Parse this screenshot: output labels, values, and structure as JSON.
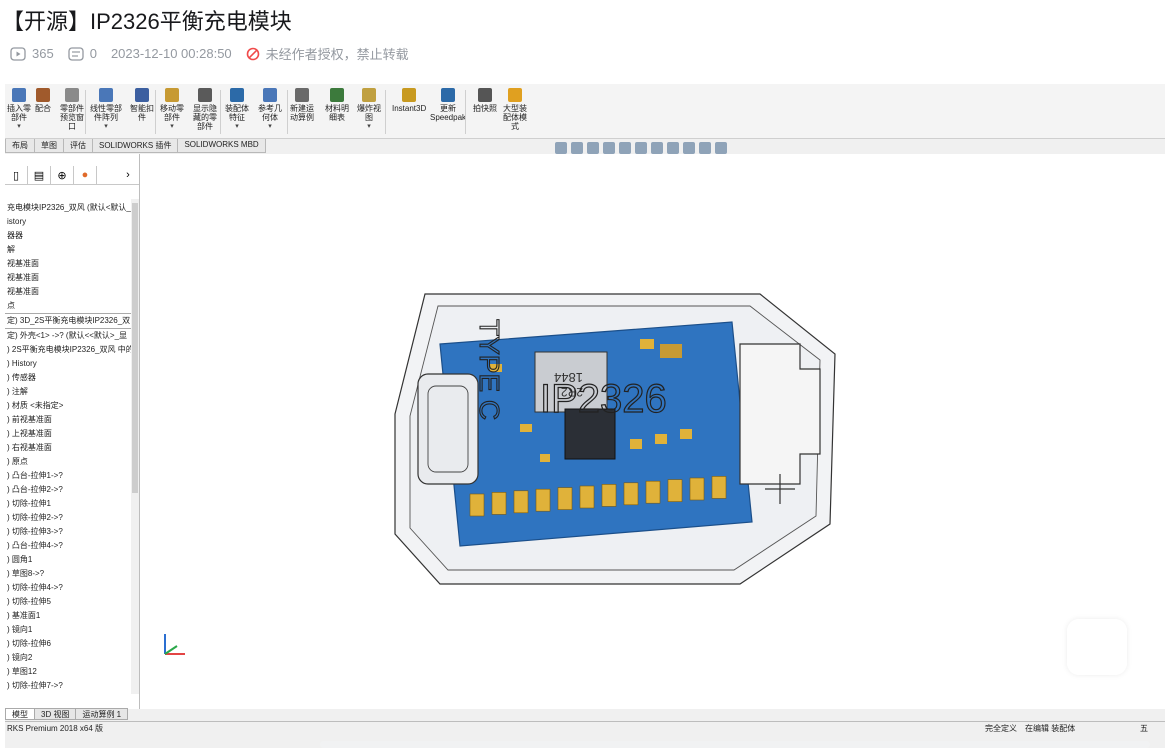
{
  "title": "【开源】IP2326平衡充电模块",
  "meta": {
    "views": "365",
    "danmaku": "0",
    "datetime": "2023-12-10 00:28:50",
    "copyright": "未经作者授权，禁止转载"
  },
  "watermark": "",
  "ribbon": {
    "buttons": [
      {
        "label": "插入零\n部件",
        "arrow": "▾"
      },
      {
        "label": "配合",
        "arrow": ""
      },
      {
        "label": "零部件\n预览窗\n口",
        "arrow": ""
      },
      {
        "label": "线性零部\n件阵列",
        "arrow": "▾"
      },
      {
        "label": "智能扣\n件",
        "arrow": ""
      },
      {
        "label": "移动零\n部件",
        "arrow": "▾"
      },
      {
        "label": "显示隐\n藏的零\n部件",
        "arrow": ""
      },
      {
        "label": "装配体\n特征",
        "arrow": "▾"
      },
      {
        "label": "参考几\n何体",
        "arrow": "▾"
      },
      {
        "label": "新建运\n动算例",
        "arrow": ""
      },
      {
        "label": "材料明\n细表",
        "arrow": ""
      },
      {
        "label": "爆炸视\n图",
        "arrow": "▾"
      },
      {
        "label": "Instant3D",
        "arrow": ""
      },
      {
        "label": "更新\nSpeedpak",
        "arrow": ""
      },
      {
        "label": "拍快照",
        "arrow": ""
      },
      {
        "label": "大型装\n配体模\n式",
        "arrow": ""
      }
    ]
  },
  "tabs": [
    "布局",
    "草图",
    "评估",
    "SOLIDWORKS 插件",
    "SOLIDWORKS MBD"
  ],
  "tree": [
    "充电模块IP2326_双风 (默认<默认_",
    "istory",
    "器器",
    "解",
    "视基准面",
    "视基准面",
    "视基准面",
    "点",
    "定) 3D_2S平衡充电模块IP2326_双",
    "定) 外壳<1> ->? (默认<<默认>_显",
    ") 2S平衡充电模块IP2326_双风 中的",
    ") History",
    ") 传感器",
    ") 注解",
    ") 材质 <未指定>",
    ") 前视基准面",
    ") 上视基准面",
    ") 右视基准面",
    ") 原点",
    ") 凸台-拉伸1->?",
    ") 凸台-拉伸2->?",
    ") 切除-拉伸1",
    ") 切除-拉伸2->?",
    ") 切除-拉伸3->?",
    ") 凸台-拉伸4->?",
    ") 圆角1",
    ") 草图8->?",
    ") 切除-拉伸4->?",
    ") 切除-拉伸5",
    ") 基准面1",
    ") 镜向1",
    ") 切除-拉伸6",
    ") 镜向2",
    ") 草图12",
    ") 切除-拉伸7->?"
  ],
  "bottom_tabs": [
    "模型",
    "3D 视图",
    "运动算例 1"
  ],
  "status": {
    "version": "RKS Premium 2018 x64 版",
    "defined": "完全定义",
    "editing": "在编辑 装配体",
    "ime": "五"
  },
  "chip": {
    "type_label": "TYPE C",
    "main_label": "IP2326",
    "small_label": "1844",
    "small_label2": "2R2"
  },
  "colors": {
    "pcb": "#2f74c0",
    "pads": "#e0b23a",
    "accent_red": "#e34444"
  }
}
